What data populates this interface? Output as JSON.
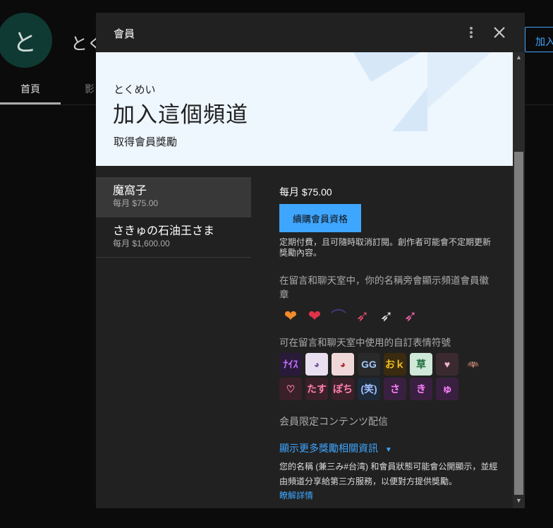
{
  "background": {
    "avatar_letter": "と",
    "channel_name": "とく",
    "join_button": "加入",
    "tabs": [
      "首頁",
      "影"
    ]
  },
  "dialog": {
    "title": "會員",
    "hero": {
      "channel_kana": "とくめい",
      "heading": "加入這個頻道",
      "caption": "取得會員獎勵"
    },
    "tiers": [
      {
        "name": "魔窩子",
        "price": "每月 $75.00",
        "selected": true
      },
      {
        "name": "さきゅの石油王さま",
        "price": "每月 $1,600.00",
        "selected": false
      }
    ],
    "detail": {
      "price": "每月 $75.00",
      "renew_button": "續購會員資格",
      "billing_note": "定期付費，且可隨時取消訂閱。創作者可能會不定期更新獎勵內容。",
      "badges_label": "在留言和聊天室中，你的名稱旁會顯示頻道會員徽章",
      "emotes_label": "可在留言和聊天室中使用的自訂表情符號",
      "exclusive_label": "会員限定コンテンツ配信",
      "more_rewards": "顯示更多獎勵相關資訊",
      "disclaimer": "您的名稱 (兼三み#台湾) 和會員狀態可能會公開顯示，並經由頻道分享給第三方服務，以便對方提供獎勵。",
      "learn_more": "瞭解詳情"
    },
    "badges": [
      {
        "icon": "heart-half-badge-icon",
        "glyph": "❤",
        "color": "#f08a2a"
      },
      {
        "icon": "heart-red-badge-icon",
        "glyph": "❤",
        "color": "#e0334a"
      },
      {
        "icon": "wing-badge-icon",
        "glyph": "⌒",
        "color": "#4d3a8c"
      },
      {
        "icon": "arrow-heart-badge-icon",
        "glyph": "➶",
        "color": "#d94a6a"
      },
      {
        "icon": "arrow-heart-white-badge-icon",
        "glyph": "➶",
        "color": "#dddddd"
      },
      {
        "icon": "arrow-heart-pink-badge-icon",
        "glyph": "➶",
        "color": "#e860a0"
      }
    ],
    "emotes": [
      {
        "icon": "nice-emote-icon",
        "text": "ﾅｲｽ",
        "bg": "#2a1a3a",
        "color": "#c070ff"
      },
      {
        "icon": "character-emote-icon",
        "text": "◕",
        "bg": "#e8e0f0",
        "color": "#7a5aa0"
      },
      {
        "icon": "character-red-emote-icon",
        "text": "◕",
        "bg": "#f0d8d8",
        "color": "#b0303a"
      },
      {
        "icon": "gg-emote-icon",
        "text": "GG",
        "bg": "#2a2a2a",
        "color": "#a0c8ff"
      },
      {
        "icon": "ok-emote-icon",
        "text": "おｋ",
        "bg": "#3a2a10",
        "color": "#f0c020"
      },
      {
        "icon": "grass-emote-icon",
        "text": "草",
        "bg": "#cfe8d8",
        "color": "#1a6a3a"
      },
      {
        "icon": "heart-emote-icon",
        "text": "♥",
        "bg": "#3a2a30",
        "color": "#f0b0d0"
      },
      {
        "icon": "bat-emote-icon",
        "text": "🦇",
        "bg": "#212121",
        "color": "#555555"
      },
      {
        "icon": "lips-emote-icon",
        "text": "♡",
        "bg": "#3a2028",
        "color": "#ff80b0"
      },
      {
        "icon": "tasu-emote-icon",
        "text": "たす",
        "bg": "#3a2028",
        "color": "#ff80b0"
      },
      {
        "icon": "pochi-emote-icon",
        "text": "ぽち",
        "bg": "#3a2028",
        "color": "#ff80b0"
      },
      {
        "icon": "laugh-emote-icon",
        "text": "(笑)",
        "bg": "#1e2a3a",
        "color": "#a0c0ff"
      },
      {
        "icon": "sa-emote-icon",
        "text": "さ",
        "bg": "#3a2040",
        "color": "#ff80ff"
      },
      {
        "icon": "ki-emote-icon",
        "text": "き",
        "bg": "#3a2040",
        "color": "#ff80ff"
      },
      {
        "icon": "yu-emote-icon",
        "text": "ゅ",
        "bg": "#3a2040",
        "color": "#ff80ff"
      }
    ]
  }
}
